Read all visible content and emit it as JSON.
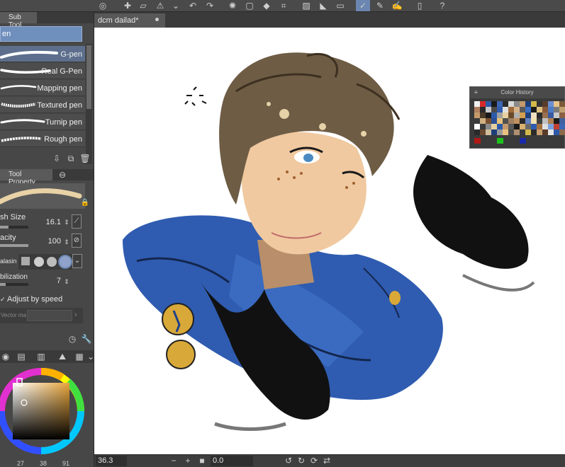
{
  "document": {
    "tab_title": "dcm dailad*"
  },
  "sub_tool": {
    "tab_label": "Sub Tool",
    "group_label": "en",
    "brushes": [
      {
        "label": "G-pen",
        "selected": true
      },
      {
        "label": "Real G-Pen",
        "selected": false
      },
      {
        "label": "Mapping pen",
        "selected": false
      },
      {
        "label": "Textured pen",
        "selected": false
      },
      {
        "label": "Turnip pen",
        "selected": false
      },
      {
        "label": "Rough pen",
        "selected": false
      }
    ]
  },
  "tool_property": {
    "tab_label": "Tool Property",
    "brush_size_label": "sh Size",
    "brush_size_value": "16.1",
    "opacity_label": "acity",
    "opacity_value": "100",
    "antialias_label": "alasin",
    "stabilization_label": "bilization",
    "stabilization_value": "7",
    "adjust_speed_label": "Adjust by speed",
    "adjust_speed_checked": true,
    "vector_label": "Vector ma"
  },
  "color_wheel": {
    "main_color": "#e8a53a",
    "readout": [
      "27",
      "38",
      "91"
    ]
  },
  "color_history": {
    "title": "Color History",
    "swatches": [
      "#f2f2f2",
      "#d62828",
      "#2d5aa8",
      "#1a1a1a",
      "#3d66b3",
      "#2b2b2b",
      "#d9d9d9",
      "#8a8a8a",
      "#c49a6c",
      "#1e3f7a",
      "#d4b84a",
      "#333333",
      "#5a3b2a",
      "#6b8fd1",
      "#e8c38a",
      "#7a5a3a",
      "#b08060",
      "#2a2a2a",
      "#c9c9c9",
      "#4a4a4a",
      "#2f5cb0",
      "#e0e0e0",
      "#a06a3a",
      "#d8b48a",
      "#5a5a5a",
      "#3a6ec4",
      "#1a1a1a",
      "#e0c080",
      "#8a5a3a",
      "#4d7bc6",
      "#7a7a7a",
      "#c0a070",
      "#c49a6c",
      "#4a3a2a",
      "#1a1a1a",
      "#2d5aa8",
      "#a0a0a0",
      "#e8d0a0",
      "#6a4a2a",
      "#b0b0b0",
      "#d4a050",
      "#1e3f7a",
      "#f0e0c0",
      "#2a2a2a",
      "#9a7050",
      "#3a5aa0",
      "#c8c8c8",
      "#8a6040",
      "#3a3a3a",
      "#d0b080",
      "#7a5030",
      "#2b4f94",
      "#e6c27a",
      "#505050",
      "#a08060",
      "#c09060",
      "#2a2a2a",
      "#6080c0",
      "#f2e0b0",
      "#404040",
      "#c0c0c0",
      "#b08050",
      "#1a1a1a",
      "#4060a0",
      "#ffffff",
      "#3a3a3a",
      "#8a8a8a",
      "#e6d0a0",
      "#2d5aa8",
      "#c49a6c",
      "#5a5a5a",
      "#1a1a1a",
      "#d8b070",
      "#6a6a6a",
      "#2f5cb0",
      "#a07040",
      "#e0e0e0",
      "#7aa0e0",
      "#c04030",
      "#3d66b3",
      "#2a2a2a",
      "#6a4a30",
      "#d0c0a0",
      "#1e3f7a",
      "#9a9a9a",
      "#e8c080",
      "#4a4a4a",
      "#b09070",
      "#3a3a3a",
      "#d4b84a",
      "#2b2b2b",
      "#c8a070",
      "#5a3b2a",
      "#e6e6e6",
      "#2d5aa8",
      "#8a6a4a"
    ],
    "recent": [
      "#b01818",
      "#1ec01e",
      "#1a2aa8"
    ]
  },
  "status": {
    "zoom": "36.3",
    "angle": "0.0"
  }
}
